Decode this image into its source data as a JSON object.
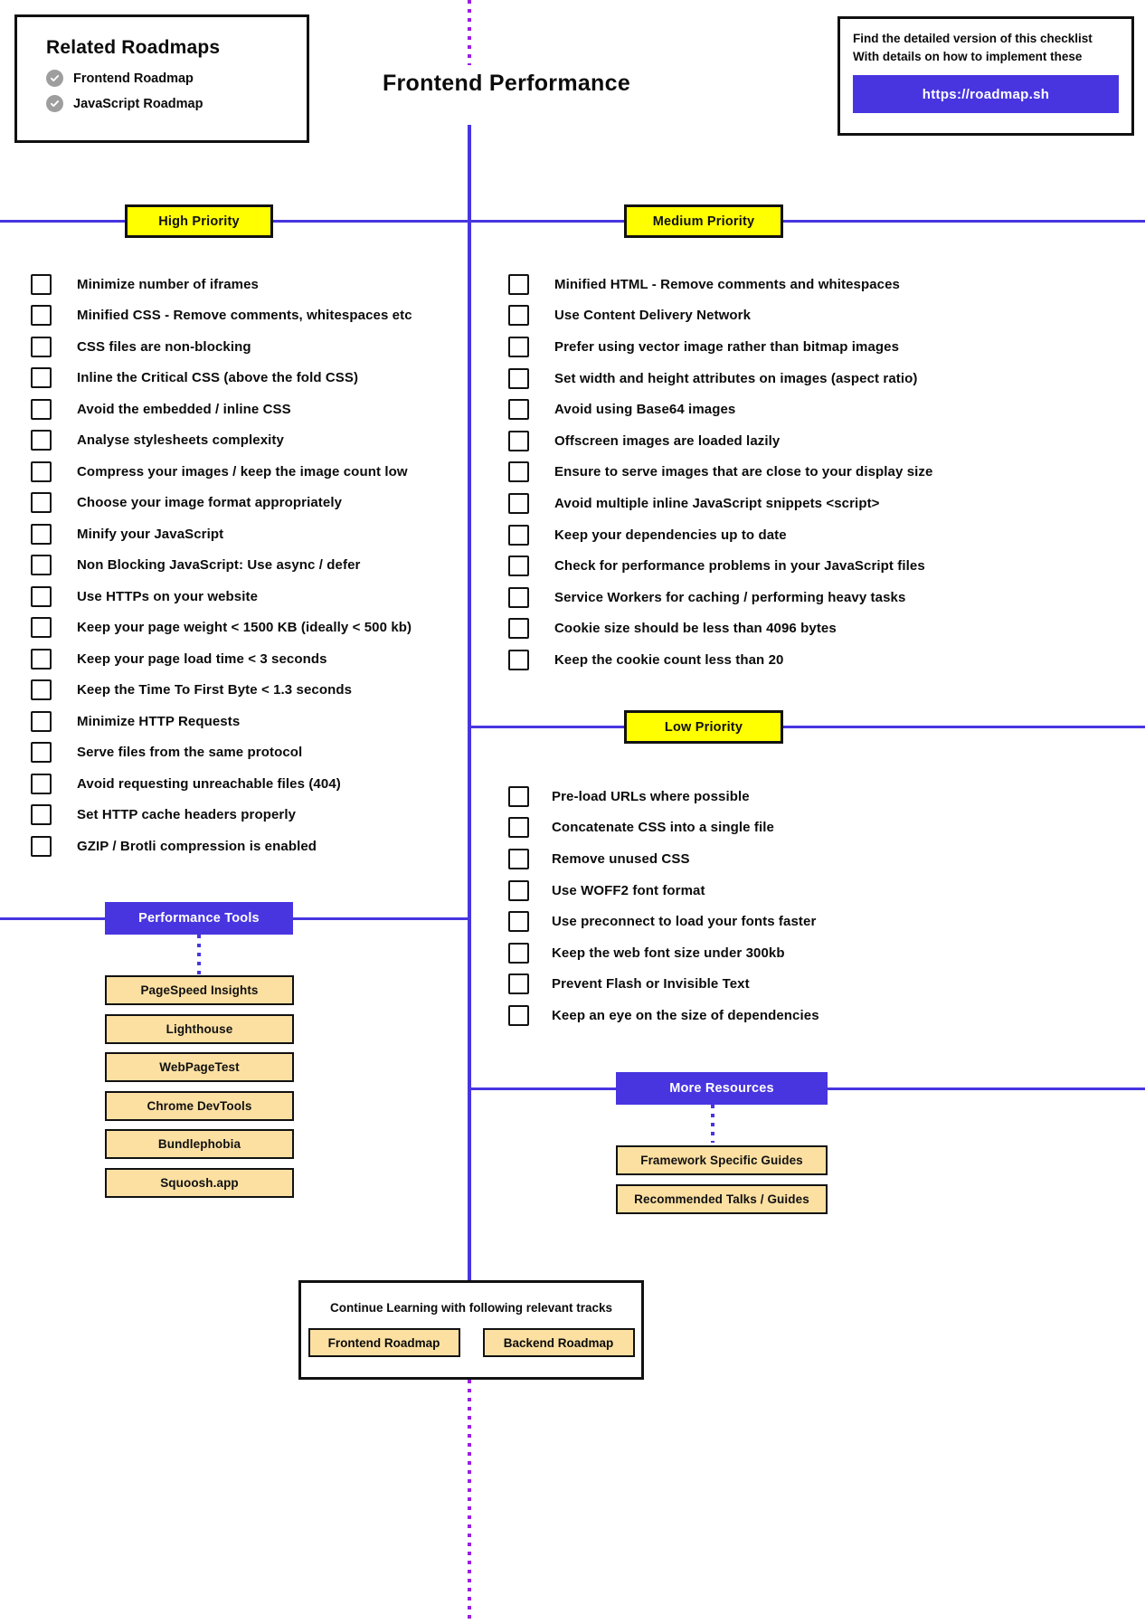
{
  "page": {
    "title": "Frontend Performance",
    "accent_blue": "#4835e0",
    "accent_yellow": "#ffff00",
    "accent_tan": "#fce0a2",
    "accent_purple_dot": "#9b1fe0"
  },
  "related_roadmaps": {
    "heading": "Related Roadmaps",
    "items": [
      {
        "label": "Frontend Roadmap",
        "icon": "check-circle-icon"
      },
      {
        "label": "JavaScript Roadmap",
        "icon": "check-circle-icon"
      }
    ]
  },
  "promo": {
    "line1": "Find the detailed version of this checklist",
    "line2": "With details on how to implement these",
    "button_label": "https://roadmap.sh"
  },
  "sections": {
    "high_priority": {
      "label": "High Priority",
      "items": [
        "Minimize number of iframes",
        "Minified CSS - Remove comments, whitespaces etc",
        "CSS files are non-blocking",
        "Inline the Critical CSS (above the fold CSS)",
        "Avoid the embedded / inline CSS",
        "Analyse stylesheets complexity",
        "Compress your images / keep the image count low",
        "Choose your image format appropriately",
        "Minify your JavaScript",
        "Non Blocking JavaScript: Use async / defer",
        "Use HTTPs on your website",
        "Keep your page weight < 1500 KB (ideally < 500 kb)",
        "Keep your page load time < 3 seconds",
        "Keep the Time To First Byte < 1.3 seconds",
        "Minimize HTTP Requests",
        "Serve files from the same protocol",
        "Avoid requesting unreachable files (404)",
        "Set HTTP cache headers properly",
        "GZIP / Brotli compression is enabled"
      ]
    },
    "medium_priority": {
      "label": "Medium Priority",
      "items": [
        "Minified HTML - Remove comments and whitespaces",
        "Use Content Delivery Network",
        "Prefer using vector image rather than bitmap images",
        "Set width and height attributes on images (aspect ratio)",
        "Avoid using Base64 images",
        "Offscreen images are loaded lazily",
        "Ensure to serve images that are close to your display size",
        "Avoid multiple inline JavaScript snippets <script>",
        "Keep your dependencies up to date",
        "Check for performance problems in your JavaScript files",
        "Service Workers for caching / performing heavy tasks",
        "Cookie size should be less than 4096 bytes",
        "Keep the cookie count less than 20"
      ]
    },
    "low_priority": {
      "label": "Low Priority",
      "items": [
        "Pre-load URLs where possible",
        "Concatenate CSS into a single file",
        "Remove unused CSS",
        "Use WOFF2 font format",
        "Use preconnect to load your fonts faster",
        "Keep the web font size under 300kb",
        "Prevent Flash or Invisible Text",
        "Keep an eye on the size of dependencies"
      ]
    },
    "performance_tools": {
      "label": "Performance Tools",
      "items": [
        "PageSpeed Insights",
        "Lighthouse",
        "WebPageTest",
        "Chrome DevTools",
        "Bundlephobia",
        "Squoosh.app"
      ]
    },
    "more_resources": {
      "label": "More Resources",
      "items": [
        "Framework Specific Guides",
        "Recommended Talks / Guides"
      ]
    }
  },
  "footer": {
    "title": "Continue Learning with following relevant tracks",
    "chips": [
      "Frontend Roadmap",
      "Backend Roadmap"
    ]
  }
}
